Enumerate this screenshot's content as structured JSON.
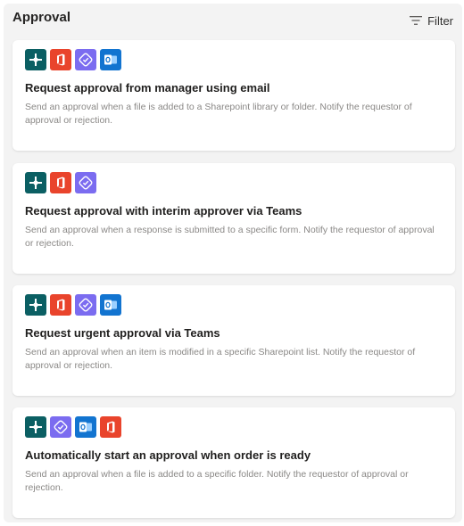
{
  "header": {
    "title": "Approval",
    "filter_label": "Filter"
  },
  "icon_colors": {
    "flow": "#0b5f63",
    "office": "#e9442c",
    "forms": "#7b6cf0",
    "outlook": "#1274d0"
  },
  "cards": [
    {
      "title": "Request approval from manager using email",
      "description": "Send an approval when a file is added to a Sharepoint library or folder. Notify the requestor of approval or rejection.",
      "icons": [
        "power-automate-icon",
        "office-icon",
        "approvals-icon",
        "outlook-icon"
      ]
    },
    {
      "title": "Request approval with interim approver via Teams",
      "description": "Send an approval when a response is submitted to a specific form. Notify the requestor of approval or rejection.",
      "icons": [
        "power-automate-icon",
        "office-icon",
        "approvals-icon"
      ]
    },
    {
      "title": "Request urgent approval via Teams",
      "description": "Send an approval when an item is modified in a specific Sharepoint list. Notify the requestor of approval or rejection.",
      "icons": [
        "power-automate-icon",
        "office-icon",
        "approvals-icon",
        "outlook-icon"
      ]
    },
    {
      "title": "Automatically start an approval when order is ready",
      "description": "Send an approval when a file is added to a specific folder. Notify the requestor of approval or rejection.",
      "icons": [
        "power-automate-icon",
        "approvals-icon",
        "outlook-icon",
        "office-icon"
      ]
    }
  ]
}
